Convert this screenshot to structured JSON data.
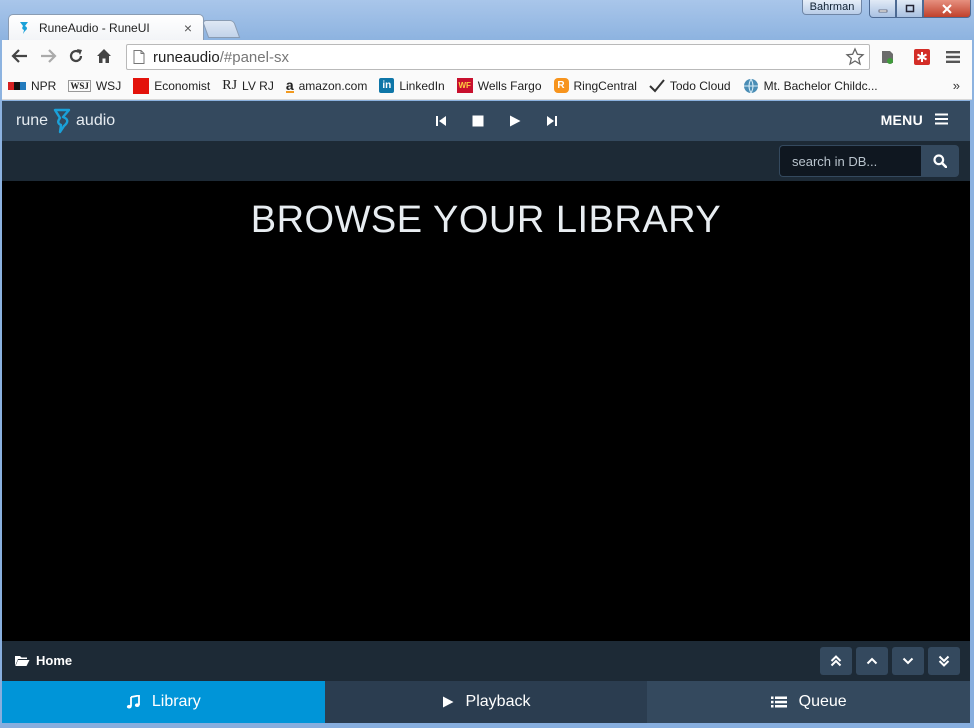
{
  "browser": {
    "tab_title": "RuneAudio - RuneUI",
    "tab_close": "×",
    "user": "Bahrman",
    "url_host": "runeaudio",
    "url_path": "/#panel-sx",
    "bookmarks": [
      {
        "label": "NPR",
        "icon": "npr-icon"
      },
      {
        "label": "WSJ",
        "icon": "wsj-icon"
      },
      {
        "label": "Economist",
        "icon": "economist-icon"
      },
      {
        "label": "LV RJ",
        "icon": "rj-icon"
      },
      {
        "label": "amazon.com",
        "icon": "amazon-icon"
      },
      {
        "label": "LinkedIn",
        "icon": "linkedin-icon"
      },
      {
        "label": "Wells Fargo",
        "icon": "wells-fargo-icon"
      },
      {
        "label": "RingCentral",
        "icon": "ringcentral-icon"
      },
      {
        "label": "Todo Cloud",
        "icon": "checkmark-icon"
      },
      {
        "label": "Mt. Bachelor Childc...",
        "icon": "globe-icon"
      }
    ],
    "bookmarks_more": "»",
    "icon_text": {
      "wsj": "WSJ",
      "rj": "RJ",
      "amazon": "a",
      "linkedin": "in",
      "wells_fargo": "WF",
      "ringcentral": "R"
    }
  },
  "app": {
    "logo_left": "rune",
    "logo_right": "audio",
    "menu_label": "MENU",
    "search_placeholder": "search in DB...",
    "title": "BROWSE YOUR LIBRARY",
    "path_home": "Home",
    "nav": {
      "library": "Library",
      "playback": "Playback",
      "queue": "Queue"
    }
  },
  "colors": {
    "header": "#34495e",
    "bar": "#1d2a36",
    "accent": "#0095d8"
  }
}
